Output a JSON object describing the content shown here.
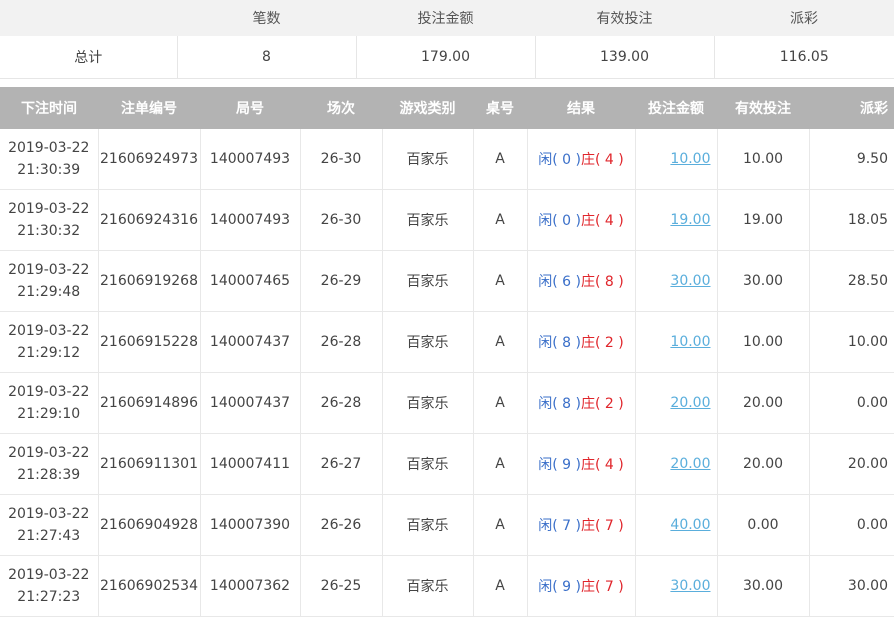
{
  "summary": {
    "headers": [
      "",
      "笔数",
      "投注金额",
      "有效投注",
      "派彩"
    ],
    "values": [
      "总计",
      "8",
      "179.00",
      "139.00",
      "116.05"
    ]
  },
  "table": {
    "headers": [
      "下注时间",
      "注单编号",
      "局号",
      "场次",
      "游戏类别",
      "桌号",
      "结果",
      "投注金额",
      "有效投注",
      "派彩"
    ],
    "rows": [
      {
        "date": "2019-03-22",
        "time": "21:30:39",
        "bet_id": "21606924973",
        "round": "140007493",
        "session": "26-30",
        "game": "百家乐",
        "table": "A",
        "player_label": "闲",
        "player_score": "( 0 )",
        "banker_label": "庄",
        "banker_score": "( 4 )",
        "amount": "10.00",
        "valid": "10.00",
        "payout": "9.50"
      },
      {
        "date": "2019-03-22",
        "time": "21:30:32",
        "bet_id": "21606924316",
        "round": "140007493",
        "session": "26-30",
        "game": "百家乐",
        "table": "A",
        "player_label": "闲",
        "player_score": "( 0 )",
        "banker_label": "庄",
        "banker_score": "( 4 )",
        "amount": "19.00",
        "valid": "19.00",
        "payout": "18.05"
      },
      {
        "date": "2019-03-22",
        "time": "21:29:48",
        "bet_id": "21606919268",
        "round": "140007465",
        "session": "26-29",
        "game": "百家乐",
        "table": "A",
        "player_label": "闲",
        "player_score": "( 6 )",
        "banker_label": "庄",
        "banker_score": "( 8 )",
        "amount": "30.00",
        "valid": "30.00",
        "payout": "28.50"
      },
      {
        "date": "2019-03-22",
        "time": "21:29:12",
        "bet_id": "21606915228",
        "round": "140007437",
        "session": "26-28",
        "game": "百家乐",
        "table": "A",
        "player_label": "闲",
        "player_score": "( 8 )",
        "banker_label": "庄",
        "banker_score": "( 2 )",
        "amount": "10.00",
        "valid": "10.00",
        "payout": "10.00"
      },
      {
        "date": "2019-03-22",
        "time": "21:29:10",
        "bet_id": "21606914896",
        "round": "140007437",
        "session": "26-28",
        "game": "百家乐",
        "table": "A",
        "player_label": "闲",
        "player_score": "( 8 )",
        "banker_label": "庄",
        "banker_score": "( 2 )",
        "amount": "20.00",
        "valid": "20.00",
        "payout": "0.00"
      },
      {
        "date": "2019-03-22",
        "time": "21:28:39",
        "bet_id": "21606911301",
        "round": "140007411",
        "session": "26-27",
        "game": "百家乐",
        "table": "A",
        "player_label": "闲",
        "player_score": "( 9 )",
        "banker_label": "庄",
        "banker_score": "( 4 )",
        "amount": "20.00",
        "valid": "20.00",
        "payout": "20.00"
      },
      {
        "date": "2019-03-22",
        "time": "21:27:43",
        "bet_id": "21606904928",
        "round": "140007390",
        "session": "26-26",
        "game": "百家乐",
        "table": "A",
        "player_label": "闲",
        "player_score": "( 7 )",
        "banker_label": "庄",
        "banker_score": "( 7 )",
        "amount": "40.00",
        "valid": "0.00",
        "payout": "0.00"
      },
      {
        "date": "2019-03-22",
        "time": "21:27:23",
        "bet_id": "21606902534",
        "round": "140007362",
        "session": "26-25",
        "game": "百家乐",
        "table": "A",
        "player_label": "闲",
        "player_score": "( 9 )",
        "banker_label": "庄",
        "banker_score": "( 7 )",
        "amount": "30.00",
        "valid": "30.00",
        "payout": "30.00"
      }
    ]
  },
  "colors": {
    "header_bg": "#b3b3b3",
    "summary_bg": "#f2f2f2",
    "player": "#3a6fc9",
    "banker": "#e0252b",
    "link": "#5aaedc"
  }
}
